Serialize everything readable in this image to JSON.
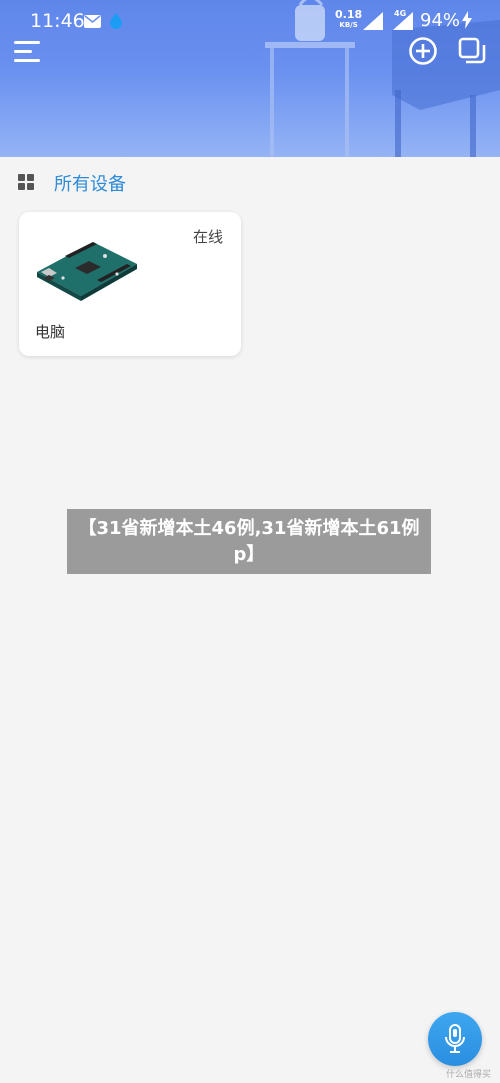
{
  "status_bar": {
    "time": "11:46",
    "speed_value": "0.18",
    "speed_unit": "KB/S",
    "network": "4G",
    "battery": "94%"
  },
  "header": {
    "menu_icon": "hamburger-menu-icon",
    "add_icon": "add-circle-icon",
    "copy_icon": "copy-icon"
  },
  "section": {
    "icon": "grid-icon",
    "title": "所有设备"
  },
  "devices": [
    {
      "status": "在线",
      "name": "电脑",
      "icon": "circuit-board-image"
    }
  ],
  "overlay_text": "【31省新增本土46例,31省新增本土61例p】",
  "fab": {
    "icon": "microphone-icon"
  },
  "watermark": "什么值得买",
  "colors": {
    "header_top": "#5f86ea",
    "accent": "#2e8bd8",
    "fab": "#2a8ee0"
  }
}
